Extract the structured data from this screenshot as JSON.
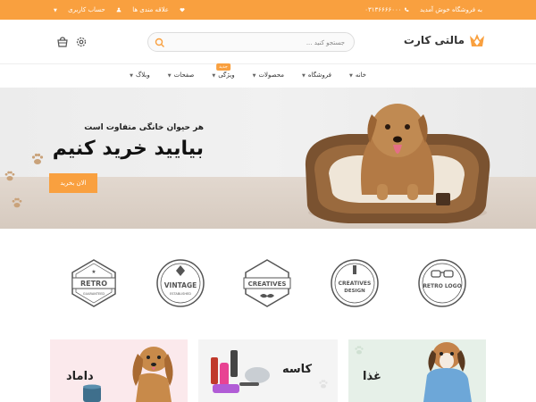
{
  "topbar": {
    "welcome": "به فروشگاه خوش آمدید",
    "phone": "۰۳۱۳۶۶۶۶۰۰۰",
    "wishlist": "علاقه مندی ها",
    "account": "حساب کاربری"
  },
  "header": {
    "logo_text": "مالتی کارت",
    "search_placeholder": "جستجو کنید ..."
  },
  "nav": {
    "items": [
      {
        "label": "خانه"
      },
      {
        "label": "فروشگاه"
      },
      {
        "label": "محصولات"
      },
      {
        "label": "ویژگی",
        "badge": "جدید"
      },
      {
        "label": "صفحات"
      },
      {
        "label": "وبلاگ"
      }
    ]
  },
  "hero": {
    "subtitle": "هر حیوان خانگی متفاوت است",
    "title": "بیایید خرید کنیم",
    "button": "الان بخرید"
  },
  "brands": [
    {
      "name": "RETRO",
      "sub": "GUARANTEED"
    },
    {
      "name": "VINTAGE",
      "sub": "ESTABLISHED"
    },
    {
      "name": "CREATIVES",
      "sub": ""
    },
    {
      "name": "CREATIVES",
      "sub": "DESIGN"
    },
    {
      "name": "RETRO LOGO",
      "sub": ""
    }
  ],
  "categories": [
    {
      "label": "غذا"
    },
    {
      "label": "کاسه"
    },
    {
      "label": "داماد"
    }
  ],
  "colors": {
    "accent": "#f9a03f",
    "topbar_text": "#ffffff"
  }
}
